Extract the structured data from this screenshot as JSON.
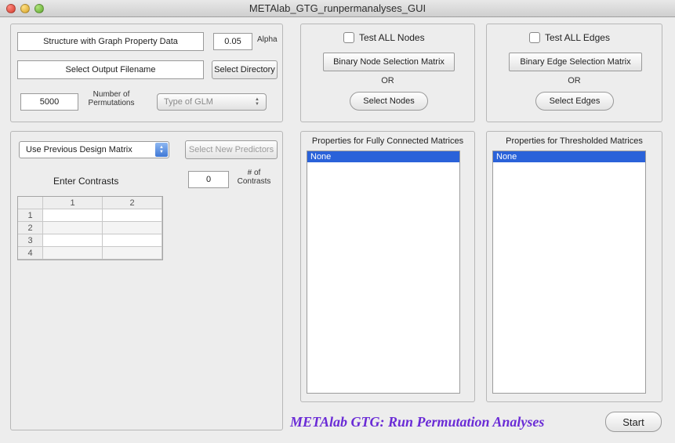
{
  "window": {
    "title": "METAlab_GTG_runpermanalyses_GUI"
  },
  "left_top": {
    "structure_label": "Structure with Graph Property Data",
    "output_label": "Select Output Filename",
    "alpha_value": "0.05",
    "alpha_label": "Alpha",
    "select_directory": "Select Directory",
    "permutations_value": "5000",
    "permutations_label_l1": "Number of",
    "permutations_label_l2": "Permutations",
    "glm_placeholder": "Type of GLM"
  },
  "predictors": {
    "design_select": "Use Previous Design Matrix",
    "new_predictors": "Select New Predictors",
    "enter_contrasts": "Enter Contrasts",
    "num_contrasts_value": "0",
    "num_contrasts_label_l1": "# of",
    "num_contrasts_label_l2": "Contrasts",
    "table_cols": [
      "1",
      "2"
    ],
    "table_rows": [
      "1",
      "2",
      "3",
      "4"
    ]
  },
  "nodes": {
    "test_all": "Test ALL Nodes",
    "selection_matrix": "Binary Node Selection Matrix",
    "or": "OR",
    "select": "Select Nodes"
  },
  "edges": {
    "test_all": "Test ALL Edges",
    "selection_matrix": "Binary Edge Selection Matrix",
    "or": "OR",
    "select": "Select Edges"
  },
  "full_props": {
    "title": "Properties for Fully Connected Matrices",
    "item": "None"
  },
  "thresh_props": {
    "title": "Properties for Thresholded Matrices",
    "item": "None"
  },
  "footer": {
    "title": "METAlab GTG: Run Permutation Analyses",
    "start": "Start"
  }
}
